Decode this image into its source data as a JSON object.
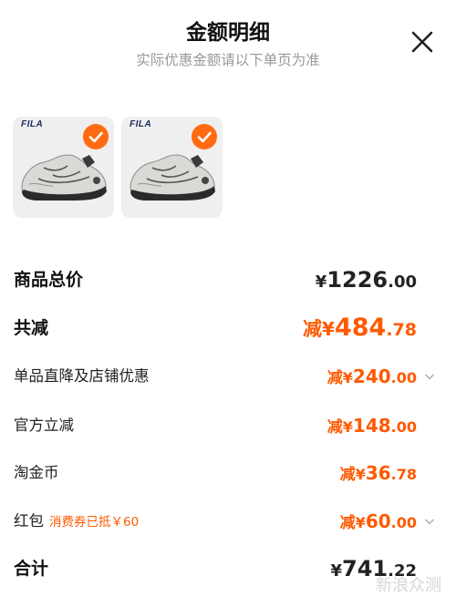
{
  "header": {
    "title": "金额明细",
    "subtitle": "实际优惠金额请以下单页为准"
  },
  "products": [
    {
      "brand": "FILA",
      "selected": true
    },
    {
      "brand": "FILA",
      "selected": true
    }
  ],
  "rows": {
    "total_price": {
      "label": "商品总价",
      "symbol": "¥",
      "integer": "1226",
      "decimal": ".00"
    },
    "total_reduction": {
      "label": "共减",
      "prefix": "减",
      "symbol": "¥",
      "integer": "484",
      "decimal": ".78"
    },
    "store_discount": {
      "label": "单品直降及店铺优惠",
      "prefix": "减",
      "symbol": "¥",
      "integer": "240",
      "decimal": ".00"
    },
    "official_discount": {
      "label": "官方立减",
      "prefix": "减",
      "symbol": "¥",
      "integer": "148",
      "decimal": ".00"
    },
    "taojinbi": {
      "label": "淘金币",
      "prefix": "减",
      "symbol": "¥",
      "integer": "36",
      "decimal": ".78"
    },
    "red_packet": {
      "label": "红包",
      "note": "消费券已抵￥60",
      "prefix": "减",
      "symbol": "¥",
      "integer": "60",
      "decimal": ".00"
    },
    "sum": {
      "label": "合计",
      "symbol": "¥",
      "integer": "741",
      "decimal": ".22"
    }
  },
  "watermark": "新浪众测",
  "colors": {
    "accent": "#ff5a00",
    "check": "#ff6a13"
  },
  "icons": [
    "close-icon",
    "checkmark-icon",
    "chevron-down-icon"
  ]
}
